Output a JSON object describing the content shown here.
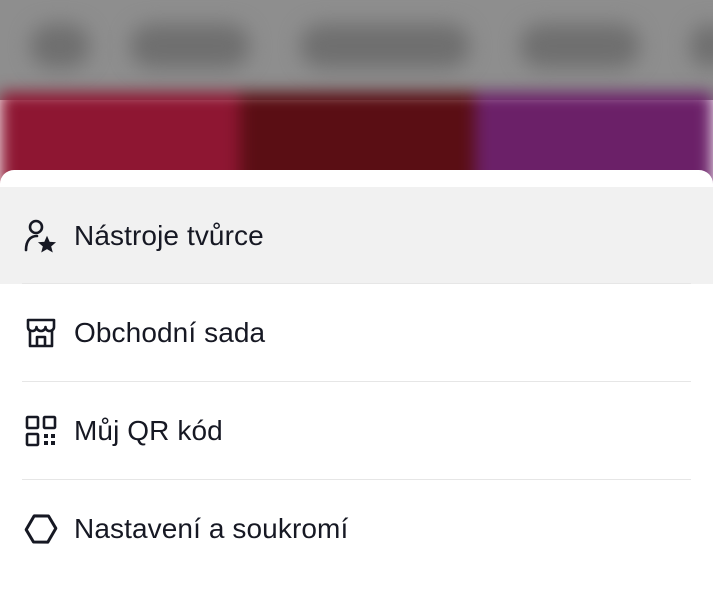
{
  "menu": {
    "items": [
      {
        "label": "Nástroje tvůrce",
        "icon": "creator-tools-icon",
        "highlighted": true
      },
      {
        "label": "Obchodní sada",
        "icon": "storefront-icon",
        "highlighted": false
      },
      {
        "label": "Můj QR kód",
        "icon": "qr-code-icon",
        "highlighted": false
      },
      {
        "label": "Nastavení a soukromí",
        "icon": "settings-gear-icon",
        "highlighted": false
      }
    ]
  },
  "colors": {
    "text": "#161823",
    "highlight": "#f1f1f1",
    "divider": "#e6e6e6",
    "band_left": "#8e1632",
    "band_middle": "#5a0e14",
    "band_right": "#6b2068"
  }
}
